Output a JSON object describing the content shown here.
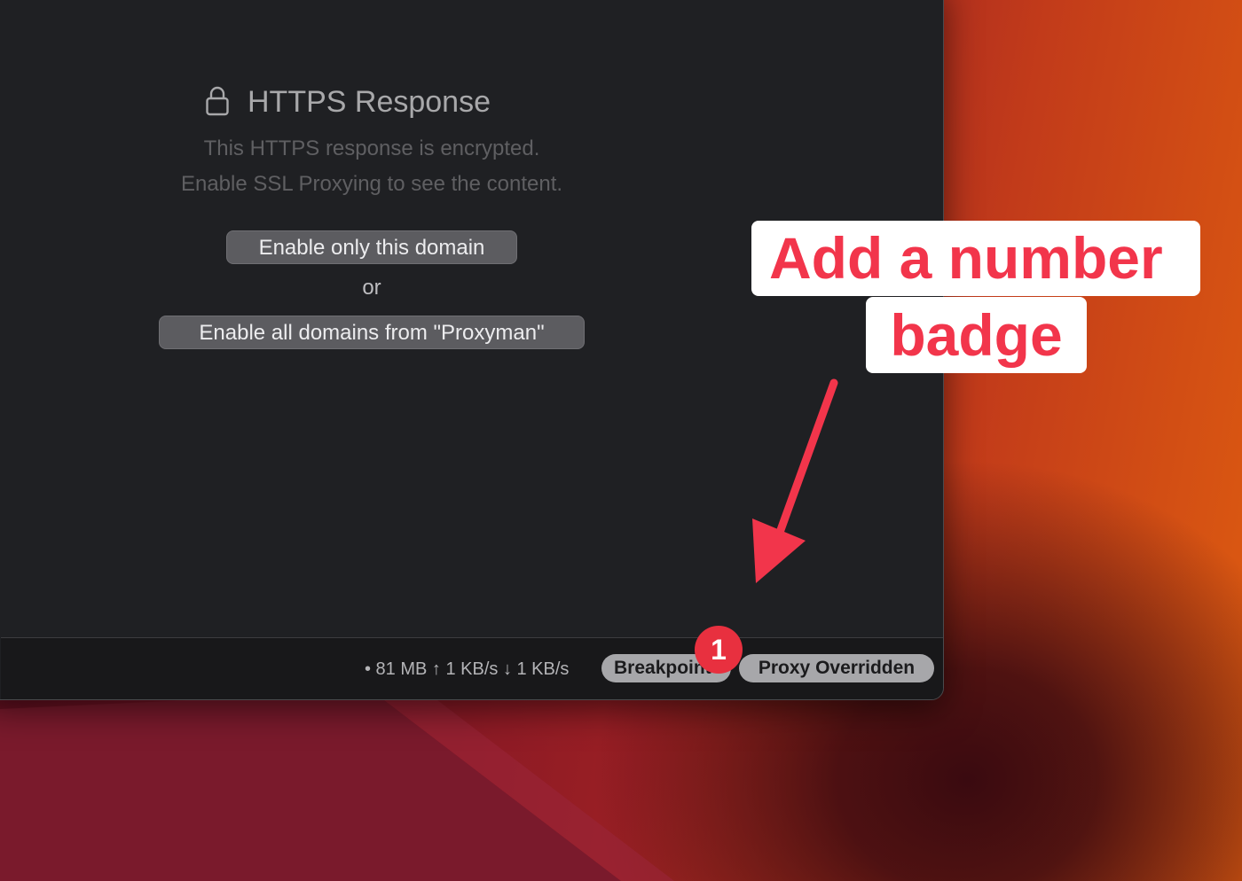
{
  "response_panel": {
    "title": "HTTPS Response",
    "description_line1": "This HTTPS response is encrypted.",
    "description_line2": "Enable SSL Proxying to see the content.",
    "enable_domain_button": "Enable only this domain",
    "or_text": "or",
    "enable_all_button": "Enable all domains from \"Proxyman\""
  },
  "status_bar": {
    "stats_text": "• 81 MB ↑ 1 KB/s ↓ 1 KB/s",
    "breakpoint_label": "Breakpoint",
    "proxy_overridden_label": "Proxy Overridden",
    "badge_count": "1"
  },
  "annotation": {
    "callout_line1": "Add a number",
    "callout_line2": "badge",
    "color": "#f2354b"
  },
  "icons": {
    "lock": "lock-icon",
    "arrow": "arrow-icon"
  }
}
